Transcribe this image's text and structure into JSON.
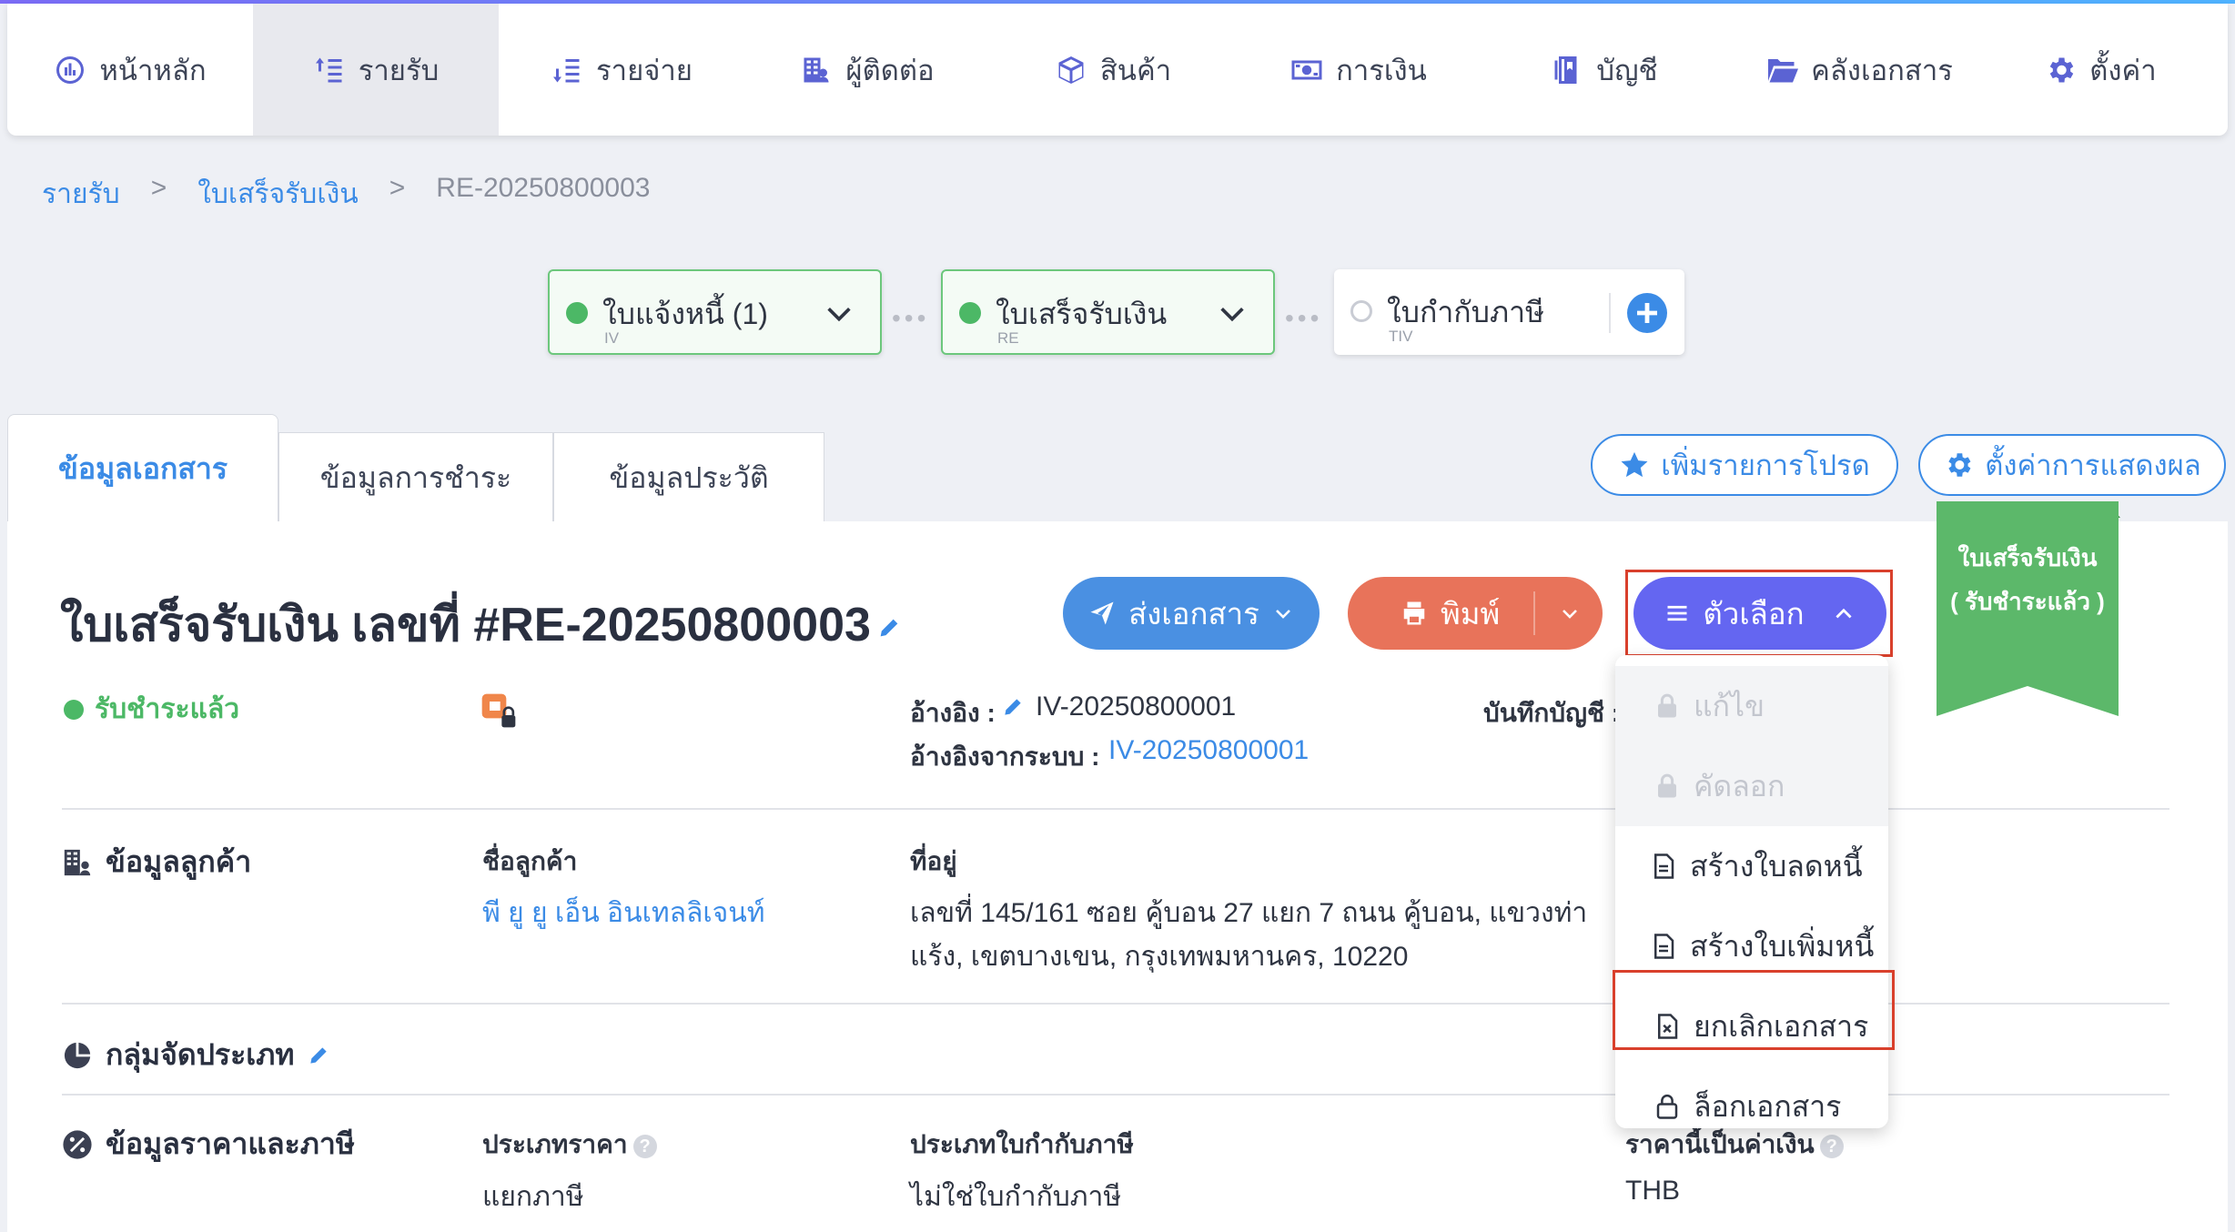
{
  "nav": [
    {
      "label": "หน้าหลัก",
      "icon": "dashboard-icon"
    },
    {
      "label": "รายรับ",
      "icon": "income-icon"
    },
    {
      "label": "รายจ่าย",
      "icon": "expense-icon"
    },
    {
      "label": "ผู้ติดต่อ",
      "icon": "contacts-icon"
    },
    {
      "label": "สินค้า",
      "icon": "product-box-icon"
    },
    {
      "label": "การเงิน",
      "icon": "money-icon"
    },
    {
      "label": "บัญชี",
      "icon": "ledger-icon"
    },
    {
      "label": "คลังเอกสาร",
      "icon": "folder-icon"
    },
    {
      "label": "ตั้งค่า",
      "icon": "gear-icon"
    }
  ],
  "breadcrumb": [
    "รายรับ",
    ">",
    "ใบเสร็จรับเงิน",
    ">",
    "RE-20250800003"
  ],
  "flow": [
    {
      "title": "ใบแจ้งหนี้ (1)",
      "code": "IV"
    },
    {
      "title": "ใบเสร็จรับเงิน",
      "code": "RE"
    },
    {
      "title": "ใบกำกับภาษี",
      "code": "TIV"
    }
  ],
  "tabs": [
    "ข้อมูลเอกสาร",
    "ข้อมูลการชำระ",
    "ข้อมูลประวัติ"
  ],
  "actions": {
    "favorite": "เพิ่มรายการโปรด",
    "display_settings": "ตั้งค่าการแสดงผล"
  },
  "ribbon": {
    "line1": "ใบเสร็จรับเงิน",
    "line2": "( รับชำระแล้ว )"
  },
  "document": {
    "title": "ใบเสร็จรับเงิน เลขที่ #RE-20250800003",
    "status": "รับชำระแล้ว"
  },
  "buttons": {
    "send": "ส่งเอกสาร",
    "print": "พิมพ์",
    "options": "ตัวเลือก"
  },
  "reference": {
    "ref_label": "อ้างอิง :",
    "ref_value": "IV-20250800001",
    "sys_label": "อ้างอิงจากระบบ :",
    "sys_value": "IV-20250800001",
    "journal_label": "บันทึกบัญชี :"
  },
  "customer": {
    "section": "ข้อมูลลูกค้า",
    "name_label": "ชื่อลูกค้า",
    "name": "พี ยู ยู เอ็น อินเทลลิเจนท์",
    "address_label": "ที่อยู่",
    "address_line1": "เลขที่ 145/161 ซอย คู้บอน 27 แยก 7 ถนน คู้บอน, แขวงท่า",
    "address_line2": "แร้ง, เขตบางเขน, กรุงเทพมหานคร, 10220"
  },
  "classification": {
    "section": "กลุ่มจัดประเภท"
  },
  "pricing": {
    "section": "ข้อมูลราคาและภาษี",
    "price_type_label": "ประเภทราคา",
    "price_type": "แยกภาษี",
    "tax_invoice_label": "ประเภทใบกำกับภาษี",
    "tax_invoice": "ไม่ใช่ใบกำกับภาษี",
    "currency_label": "ราคานี้เป็นค่าเงิน",
    "currency": "THB"
  },
  "menu": [
    {
      "label": "แก้ไข",
      "icon": "lock-icon",
      "disabled": true
    },
    {
      "label": "คัดลอก",
      "icon": "lock-icon",
      "disabled": true
    },
    {
      "label": "สร้างใบลดหนี้",
      "icon": "document-icon",
      "disabled": false
    },
    {
      "label": "สร้างใบเพิ่มหนี้",
      "icon": "document-icon",
      "disabled": false
    },
    {
      "label": "ยกเลิกเอกสาร",
      "icon": "document-cancel-icon",
      "disabled": false
    },
    {
      "label": "ล็อกเอกสาร",
      "icon": "lock-outline-icon",
      "disabled": false
    }
  ],
  "colors": {
    "accent": "#3b8be6",
    "success": "#4cb866",
    "print": "#e8735a",
    "options": "#6466f1",
    "highlight": "#d9402c"
  }
}
